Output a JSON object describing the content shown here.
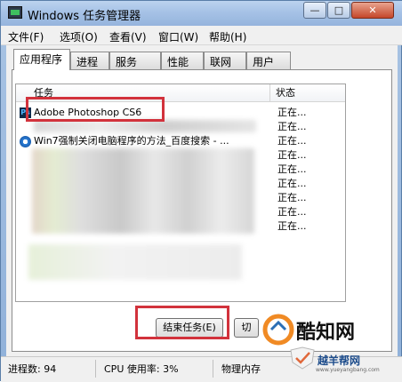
{
  "window": {
    "title": "Windows 任务管理器",
    "min_glyph": "—",
    "max_glyph": "□",
    "close_glyph": "✕"
  },
  "menu": [
    {
      "label": "文件(F)"
    },
    {
      "label": "选项(O)"
    },
    {
      "label": "查看(V)"
    },
    {
      "label": "窗口(W)"
    },
    {
      "label": "帮助(H)"
    }
  ],
  "tabs": [
    {
      "label": "应用程序",
      "active": true
    },
    {
      "label": "进程"
    },
    {
      "label": "服务"
    },
    {
      "label": "性能"
    },
    {
      "label": "联网"
    },
    {
      "label": "用户"
    }
  ],
  "list": {
    "col_task": "任务",
    "col_status": "状态",
    "rows": [
      {
        "task": "Adobe Photoshop CS6",
        "status": "正在...",
        "icon": "photoshop-icon"
      },
      {
        "task": "",
        "status": "正在...",
        "icon": ""
      },
      {
        "task": "Win7强制关闭电脑程序的方法_百度搜索 - ...",
        "status": "正在...",
        "icon": "ie-icon"
      },
      {
        "task": "",
        "status": "正在...",
        "icon": ""
      },
      {
        "task": "",
        "status": "正在...",
        "icon": ""
      },
      {
        "task": "",
        "status": "正在...",
        "icon": ""
      },
      {
        "task": "",
        "status": "正在...",
        "icon": ""
      },
      {
        "task": "",
        "status": "正在...",
        "icon": ""
      },
      {
        "task": "",
        "status": "正在...",
        "icon": ""
      }
    ]
  },
  "buttons": {
    "end_task": "结束任务(E)",
    "switch_to": "切"
  },
  "statusbar": {
    "processes": "进程数: 94",
    "cpu": "CPU 使用率: 3%",
    "memory": "物理内存"
  },
  "watermark": {
    "brand": "酷知网",
    "site_cn": "越羊帮网",
    "site_url": "www.yueyangbang.com"
  },
  "colors": {
    "highlight": "#d2323c",
    "titlebar": "#a6c2e6"
  }
}
